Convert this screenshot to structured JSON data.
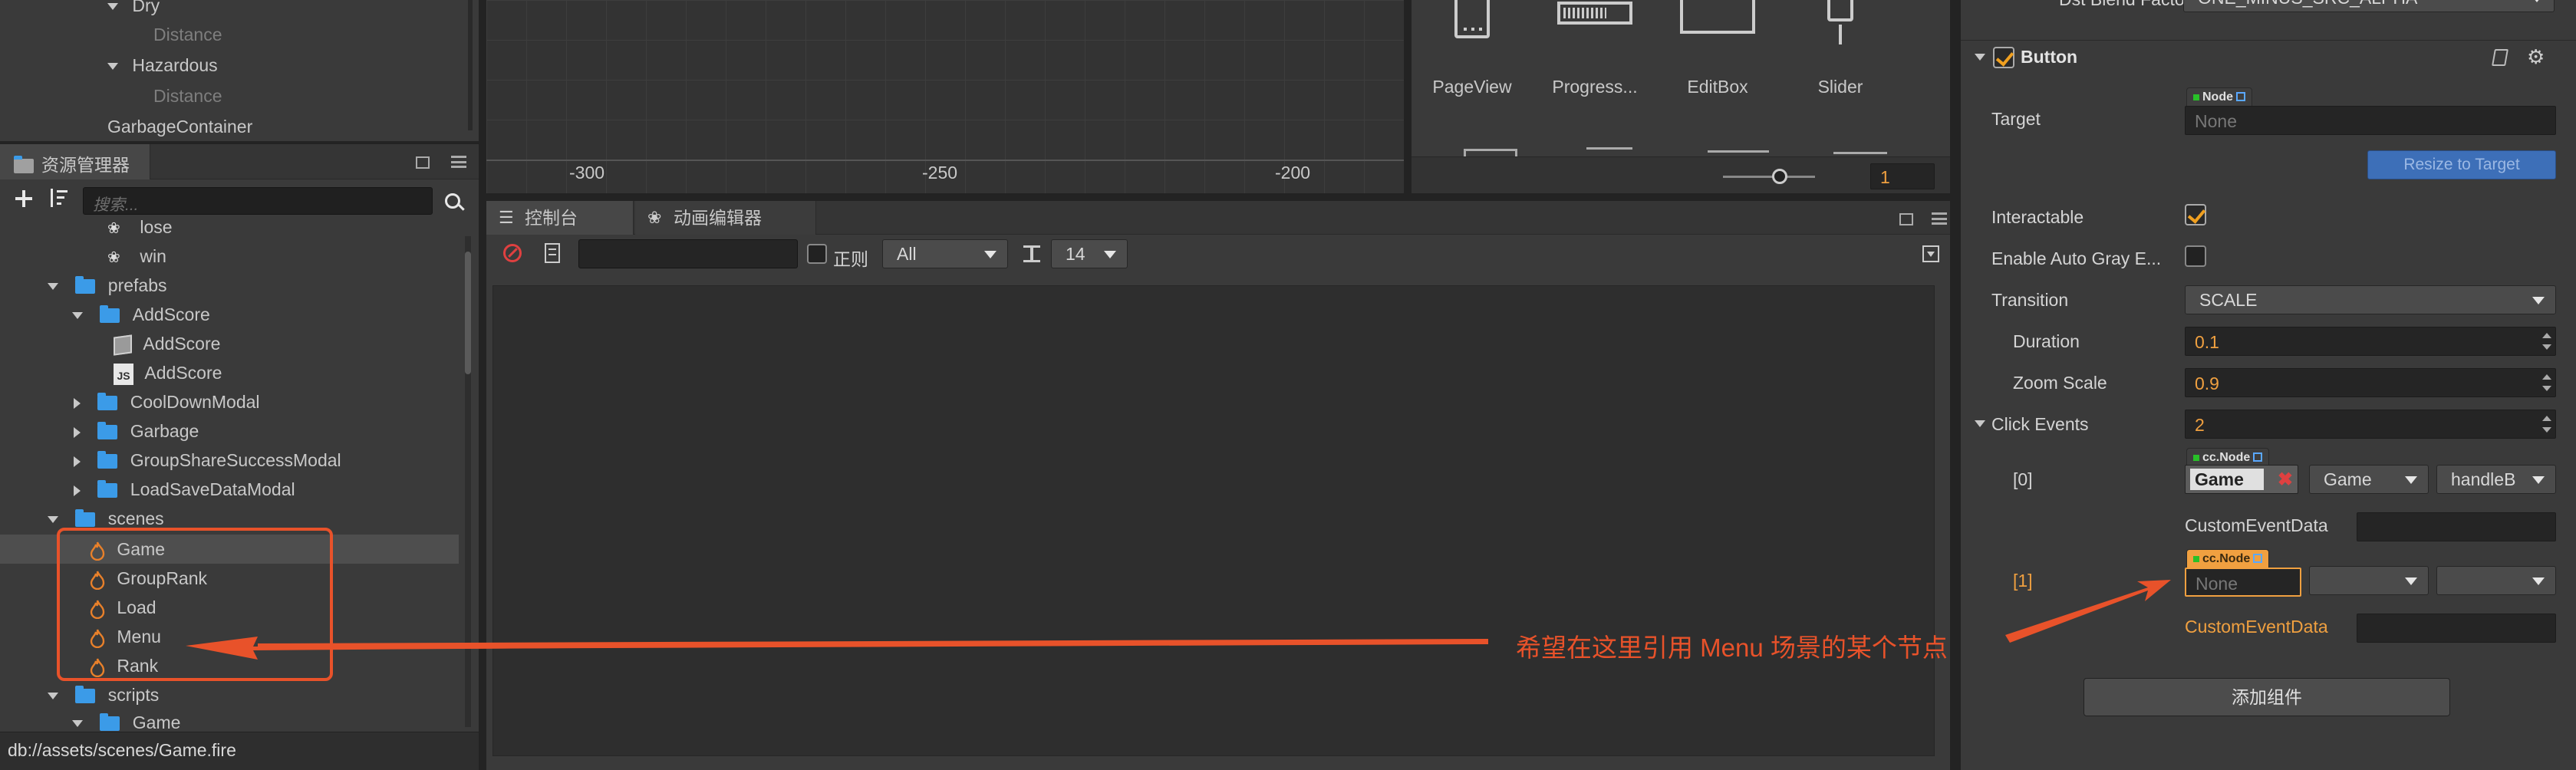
{
  "hierarchy": {
    "items": [
      {
        "label": "Dry",
        "type": "toggle-open"
      },
      {
        "label": "Distance",
        "type": "dim"
      },
      {
        "label": "Hazardous",
        "type": "toggle-open"
      },
      {
        "label": "Distance",
        "type": "dim"
      },
      {
        "label": "GarbageContainer",
        "type": "plain"
      }
    ]
  },
  "assets": {
    "title": "资源管理器",
    "search_placeholder": "搜索...",
    "tree": [
      {
        "label": "lose",
        "icon": "anim-icon"
      },
      {
        "label": "win",
        "icon": "anim-icon"
      },
      {
        "label": "prefabs",
        "icon": "folder-icon"
      },
      {
        "label": "AddScore",
        "icon": "folder-icon"
      },
      {
        "label": "AddScore",
        "icon": "prefab-icon"
      },
      {
        "label": "AddScore",
        "icon": "js-icon"
      },
      {
        "label": "CoolDownModal",
        "icon": "folder-icon"
      },
      {
        "label": "Garbage",
        "icon": "folder-icon"
      },
      {
        "label": "GroupShareSuccessModal",
        "icon": "folder-icon"
      },
      {
        "label": "LoadSaveDataModal",
        "icon": "folder-icon"
      },
      {
        "label": "scenes",
        "icon": "folder-icon"
      },
      {
        "label": "Game",
        "icon": "fire-icon"
      },
      {
        "label": "GroupRank",
        "icon": "fire-icon"
      },
      {
        "label": "Load",
        "icon": "fire-icon"
      },
      {
        "label": "Menu",
        "icon": "fire-icon"
      },
      {
        "label": "Rank",
        "icon": "fire-icon"
      },
      {
        "label": "scripts",
        "icon": "folder-icon"
      },
      {
        "label": "Game",
        "icon": "folder-icon"
      }
    ],
    "status_path": "db://assets/scenes/Game.fire",
    "js_badge": "JS"
  },
  "scene": {
    "axis_labels": [
      "-300",
      "-250",
      "-200"
    ]
  },
  "console": {
    "tab_console": "控制台",
    "tab_animation": "动画编辑器",
    "regex_label": "正则",
    "level_select": "All",
    "font_size_select": "14"
  },
  "widgets": {
    "items": [
      "PageView",
      "Progress...",
      "EditBox",
      "Slider"
    ],
    "zoom_value": "1"
  },
  "inspector": {
    "top_cut_label": "Dst Blend Factor",
    "top_cut_value": "ONE_MINUS_SRC_ALPHA",
    "component_title": "Button",
    "target_label": "Target",
    "node_tag": "Node",
    "node_none": "None",
    "resize_button": "Resize to Target",
    "interactable_label": "Interactable",
    "auto_gray_label": "Enable Auto Gray E...",
    "transition_label": "Transition",
    "transition_value": "SCALE",
    "duration_label": "Duration",
    "duration_value": "0.1",
    "zoom_scale_label": "Zoom Scale",
    "zoom_scale_value": "0.9",
    "click_events_label": "Click Events",
    "click_events_count": "2",
    "event0_index": "[0]",
    "event0_tag": "cc.Node",
    "event0_node": "Game",
    "event0_component": "Game",
    "event0_handler": "handleB",
    "custom_event_data_label": "CustomEventData",
    "event1_index": "[1]",
    "event1_tag": "cc.Node",
    "event1_node": "None",
    "add_component_button": "添加组件"
  },
  "annotation": {
    "text": "希望在这里引用 Menu 场景的某个节点",
    "color": "#e8522a"
  },
  "colors": {
    "accent_orange": "#f0a040",
    "selection_blue": "#3b7bd0",
    "folder_blue": "#3b9be8",
    "annotation_red": "#e8522a"
  }
}
